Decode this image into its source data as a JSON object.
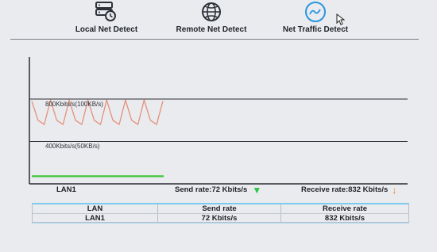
{
  "toolbar": {
    "items": [
      {
        "label": "Local Net Detect",
        "icon": "local-net-icon"
      },
      {
        "label": "Remote Net Detect",
        "icon": "globe-icon"
      },
      {
        "label": "Net Traffic Detect",
        "icon": "traffic-wave-icon",
        "active": true
      }
    ]
  },
  "chart": {
    "tick_labels": [
      "800Kbits/s(100KB/s)",
      "400Kbits/s(50KB/s)"
    ],
    "receive_color": "#e5917a",
    "send_color": "#3fc63c",
    "chart_data": {
      "type": "line",
      "title": "",
      "ylim_label_top": "800Kbits/s(100KB/s)",
      "gridlines_kbits": [
        800,
        400
      ],
      "series": [
        {
          "name": "",
          "color": "#e5917a",
          "values": [
            780,
            600,
            560,
            790,
            600,
            560,
            790,
            600,
            560,
            790,
            600,
            560,
            790,
            600,
            560,
            790,
            600,
            560,
            790,
            600,
            560,
            780
          ]
        },
        {
          "name": "",
          "color": "#3fc63c",
          "values": [
            72,
            72,
            72,
            72,
            72,
            72,
            72,
            72,
            72,
            72,
            72,
            72,
            72,
            72,
            72,
            72,
            72,
            72,
            72,
            72,
            72,
            72
          ]
        }
      ]
    }
  },
  "stats": {
    "interface": "LAN1",
    "send_rate": "Send rate:72 Kbits/s",
    "receive_rate": "Receive rate:832 Kbits/s"
  },
  "table": {
    "headers": [
      "LAN",
      "Send rate",
      "Receive rate"
    ],
    "rows": [
      [
        "LAN1",
        "72 Kbits/s",
        "832 Kbits/s"
      ]
    ]
  },
  "colors": {
    "accent": "#2a95e0",
    "send_arrow": "#2ec44a",
    "receive_arrow": "#ee7a1c"
  }
}
